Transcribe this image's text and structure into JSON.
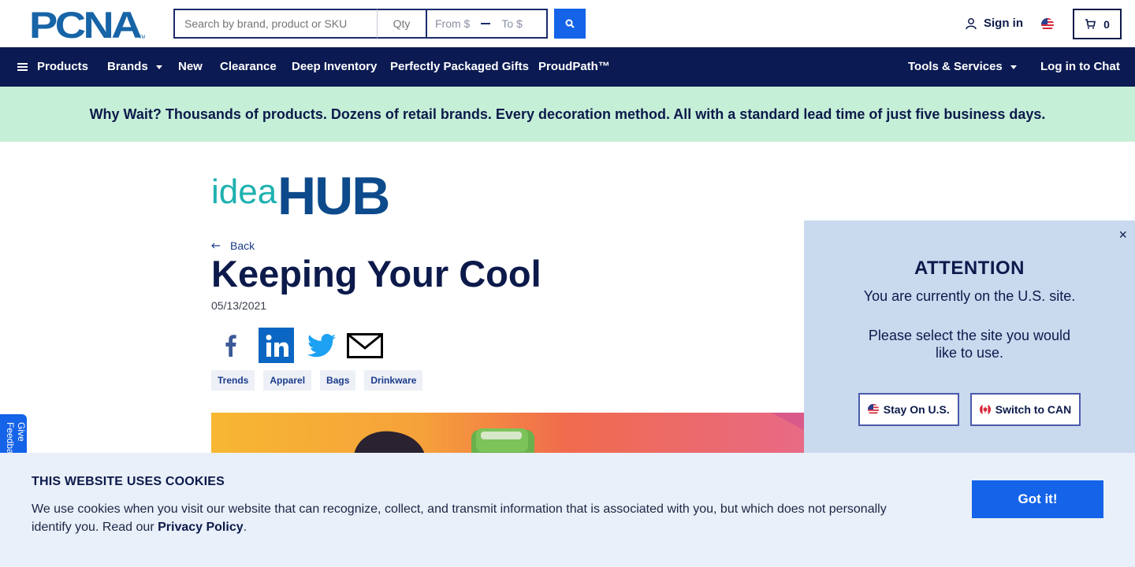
{
  "header": {
    "logo_text": "PCNA",
    "search_placeholder": "Search by brand, product or SKU",
    "qty_placeholder": "Qty",
    "price_from": "From $",
    "price_to": "To $",
    "signin_label": "Sign in",
    "cart_count": "0"
  },
  "nav": {
    "products": "Products",
    "brands": "Brands",
    "new": "New",
    "clearance": "Clearance",
    "deep_inventory": "Deep Inventory",
    "gifts": "Perfectly Packaged Gifts",
    "proudpath": "ProudPath™",
    "tools": "Tools & Services",
    "chat": "Log in to Chat"
  },
  "promo": {
    "text": "Why Wait? Thousands of products. Dozens of retail brands. Every decoration method. All with a standard lead time of just five business days."
  },
  "article": {
    "logo_idea": "idea",
    "logo_hub": "HUB",
    "back_label": "Back",
    "title": "Keeping Your Cool",
    "date": "05/13/2021",
    "tags": [
      "Trends",
      "Apparel",
      "Bags",
      "Drinkware"
    ]
  },
  "feedback": {
    "label": "Give Feedback"
  },
  "attention": {
    "close": "×",
    "heading": "ATTENTION",
    "message": "You are currently on the U.S. site.",
    "message2": "Please select the site you would like to use.",
    "stay_label": "Stay On U.S.",
    "switch_label": "Switch to CAN"
  },
  "cookie": {
    "heading": "THIS WEBSITE USES COOKIES",
    "body": "We use cookies when you visit our website that can recognize, collect, and transmit information that is associated with you, but which does not personally identify you. Read our ",
    "link": "Privacy Policy",
    "period": ".",
    "button": "Got it!"
  },
  "colors": {
    "navy": "#0b1a52",
    "blue": "#1463e8",
    "promo_green": "#c6efd7",
    "attention_bg": "#c9d9ee",
    "cookie_bg": "#e9f0f9"
  }
}
